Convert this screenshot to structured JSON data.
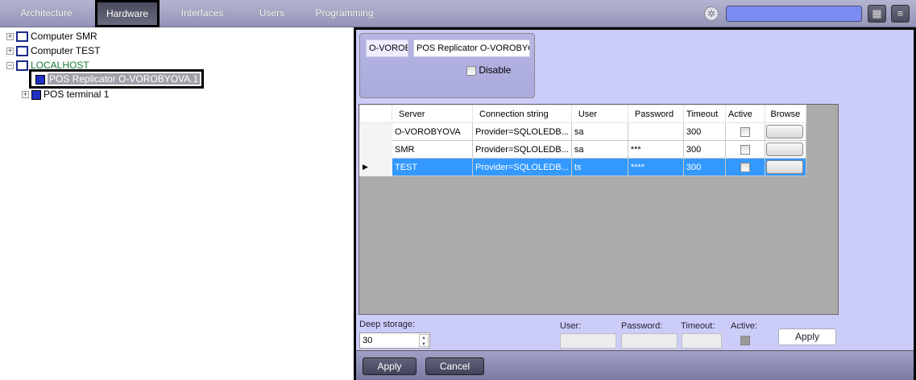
{
  "topbar": {
    "tabs": [
      "Architecture",
      "Hardware",
      "Interfaces",
      "Users",
      "Programming"
    ],
    "active_tab": "Hardware",
    "search_value": ""
  },
  "tree": {
    "items": [
      {
        "label": "Computer SMR",
        "expander": "+"
      },
      {
        "label": "Computer TEST",
        "expander": "+"
      },
      {
        "label": "LOCALHOST",
        "expander": "−"
      },
      {
        "label": "POS Replicator O-VOROBYOVA.1"
      },
      {
        "label": "POS terminal 1",
        "expander": "+"
      }
    ]
  },
  "object": {
    "id": "O-VOROE",
    "name": "POS Replicator O-VOROBYO'",
    "disable_label": "Disable"
  },
  "grid": {
    "columns": [
      "Server",
      "Connection string",
      "User",
      "Password",
      "Timeout",
      "Active",
      "Browse"
    ],
    "rows": [
      {
        "server": "O-VOROBYOVA",
        "conn": "Provider=SQLOLEDB...",
        "user": "sa",
        "password": "",
        "timeout": "300"
      },
      {
        "server": "SMR",
        "conn": "Provider=SQLOLEDB...",
        "user": "sa",
        "password": "***",
        "timeout": "300"
      },
      {
        "server": "TEST",
        "conn": "Provider=SQLOLEDB...",
        "user": "ts",
        "password": "****",
        "timeout": "300",
        "selected": true
      }
    ]
  },
  "bottom": {
    "deep_storage_label": "Deep storage:",
    "deep_storage_value": "30",
    "user_label": "User:",
    "password_label": "Password:",
    "timeout_label": "Timeout:",
    "active_label": "Active:",
    "apply_label": "Apply"
  },
  "footer": {
    "apply": "Apply",
    "cancel": "Cancel"
  },
  "colors": {
    "selection": "#3399ff",
    "panel": "#ccccf8",
    "tree_localhost": "#1a7a3a"
  }
}
